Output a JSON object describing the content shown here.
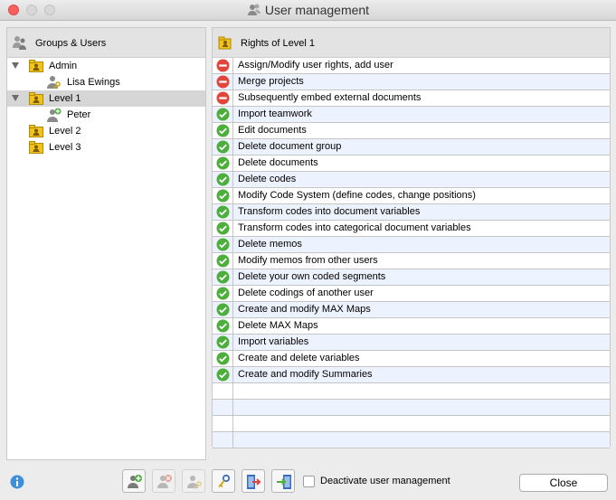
{
  "window": {
    "title": "User management"
  },
  "groups_panel": {
    "title": "Groups & Users",
    "tree": [
      {
        "label": "Admin",
        "type": "group",
        "expanded": true
      },
      {
        "label": "Lisa Ewings",
        "type": "user"
      },
      {
        "label": "Level 1",
        "type": "group",
        "expanded": true,
        "selected": true
      },
      {
        "label": "Peter",
        "type": "user"
      },
      {
        "label": "Level 2",
        "type": "group"
      },
      {
        "label": "Level 3",
        "type": "group"
      }
    ]
  },
  "rights_panel": {
    "title": "Rights of Level 1",
    "rights": [
      {
        "label": "Assign/Modify user rights, add user",
        "allowed": false
      },
      {
        "label": "Merge projects",
        "allowed": false
      },
      {
        "label": "Subsequently embed external documents",
        "allowed": false
      },
      {
        "label": "Import teamwork",
        "allowed": true
      },
      {
        "label": "Edit documents",
        "allowed": true
      },
      {
        "label": "Delete document group",
        "allowed": true
      },
      {
        "label": "Delete documents",
        "allowed": true
      },
      {
        "label": "Delete codes",
        "allowed": true
      },
      {
        "label": "Modify Code System (define codes, change positions)",
        "allowed": true
      },
      {
        "label": "Transform codes into document variables",
        "allowed": true
      },
      {
        "label": "Transform codes into categorical document variables",
        "allowed": true
      },
      {
        "label": "Delete memos",
        "allowed": true
      },
      {
        "label": "Modify memos from other users",
        "allowed": true
      },
      {
        "label": "Delete your own coded segments",
        "allowed": true
      },
      {
        "label": "Delete codings of another user",
        "allowed": true
      },
      {
        "label": "Create and modify MAX Maps",
        "allowed": true
      },
      {
        "label": "Delete MAX Maps",
        "allowed": true
      },
      {
        "label": "Import variables",
        "allowed": true
      },
      {
        "label": "Create and delete variables",
        "allowed": true
      },
      {
        "label": "Create and modify Summaries",
        "allowed": true
      }
    ],
    "empty_rows": 4
  },
  "toolbar": {
    "buttons": [
      {
        "name": "add-user-button",
        "icon": "add-user-icon",
        "enabled": true
      },
      {
        "name": "remove-user-button",
        "icon": "remove-user-icon",
        "enabled": false
      },
      {
        "name": "edit-user-button",
        "icon": "user-key-icon",
        "enabled": false
      },
      {
        "name": "change-password-button",
        "icon": "key-icon",
        "enabled": true
      },
      {
        "name": "export-button",
        "icon": "export-icon",
        "enabled": true
      },
      {
        "name": "import-button",
        "icon": "import-icon",
        "enabled": true
      }
    ],
    "deactivate_label": "Deactivate user management",
    "deactivate_checked": false,
    "close_label": "Close"
  },
  "colors": {
    "allowed": "#4cae3b",
    "denied": "#e0463c",
    "alt_row": "#edf3fe",
    "selected_row": "#d6d6d6",
    "folder": "#f2c318"
  }
}
